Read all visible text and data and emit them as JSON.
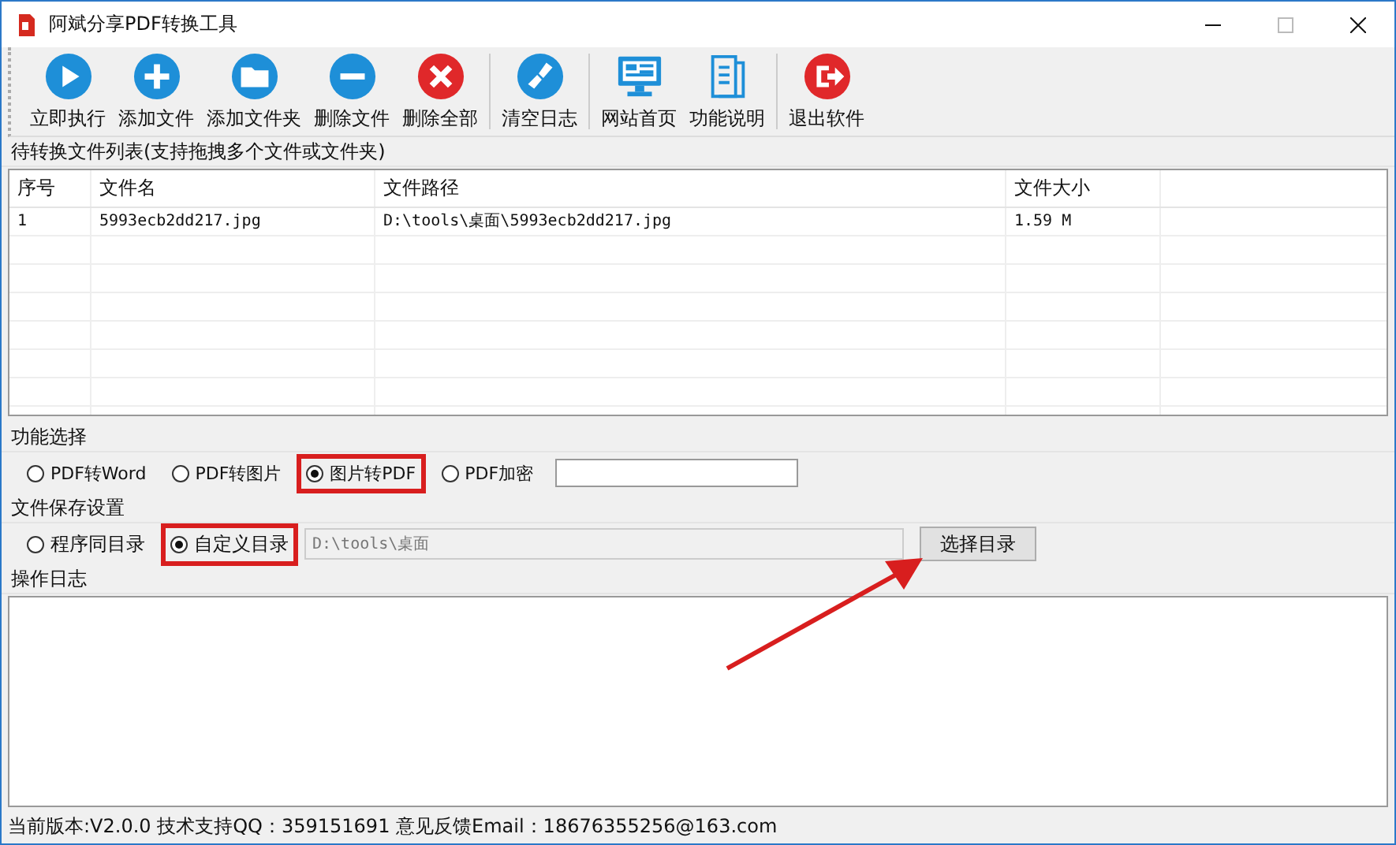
{
  "window": {
    "title": "阿斌分享PDF转换工具"
  },
  "toolbar": [
    [
      {
        "label": "立即执行",
        "color": "#1e8fd8"
      },
      {
        "label": "添加文件",
        "color": "#1e8fd8"
      },
      {
        "label": "添加文件夹",
        "color": "#1e8fd8"
      },
      {
        "label": "删除文件",
        "color": "#1e8fd8"
      },
      {
        "label": "删除全部",
        "color": "#e0282a"
      }
    ],
    [
      {
        "label": "清空日志",
        "color": "#1e8fd8"
      }
    ],
    [
      {
        "label": "网站首页",
        "color": "#1e8fd8"
      },
      {
        "label": "功能说明",
        "color": "#1e8fd8"
      }
    ],
    [
      {
        "label": "退出软件",
        "color": "#e0282a"
      }
    ]
  ],
  "file_list": {
    "title": "待转换文件列表(支持拖拽多个文件或文件夹)",
    "columns": [
      "序号",
      "文件名",
      "文件路径",
      "文件大小"
    ],
    "rows": [
      [
        "1",
        "5993ecb2dd217.jpg",
        "D:\\tools\\桌面\\5993ecb2dd217.jpg",
        "1.59 M"
      ]
    ]
  },
  "function": {
    "title": "功能选择",
    "options": [
      {
        "label": "PDF转Word",
        "selected": false,
        "highlighted": false
      },
      {
        "label": "PDF转图片",
        "selected": false,
        "highlighted": false
      },
      {
        "label": "图片转PDF",
        "selected": true,
        "highlighted": true
      },
      {
        "label": "PDF加密",
        "selected": false,
        "highlighted": false
      }
    ]
  },
  "save": {
    "title": "文件保存设置",
    "options": [
      {
        "label": "程序同目录",
        "selected": false,
        "highlighted": false
      },
      {
        "label": "自定义目录",
        "selected": true,
        "highlighted": true
      }
    ],
    "path": "D:\\tools\\桌面",
    "button": "选择目录",
    "arrow_to_button": true
  },
  "log": {
    "title": "操作日志"
  },
  "status_bar": "当前版本:V2.0.0  技术支持QQ：359151691  意见反馈Email：18676355256@163.com"
}
